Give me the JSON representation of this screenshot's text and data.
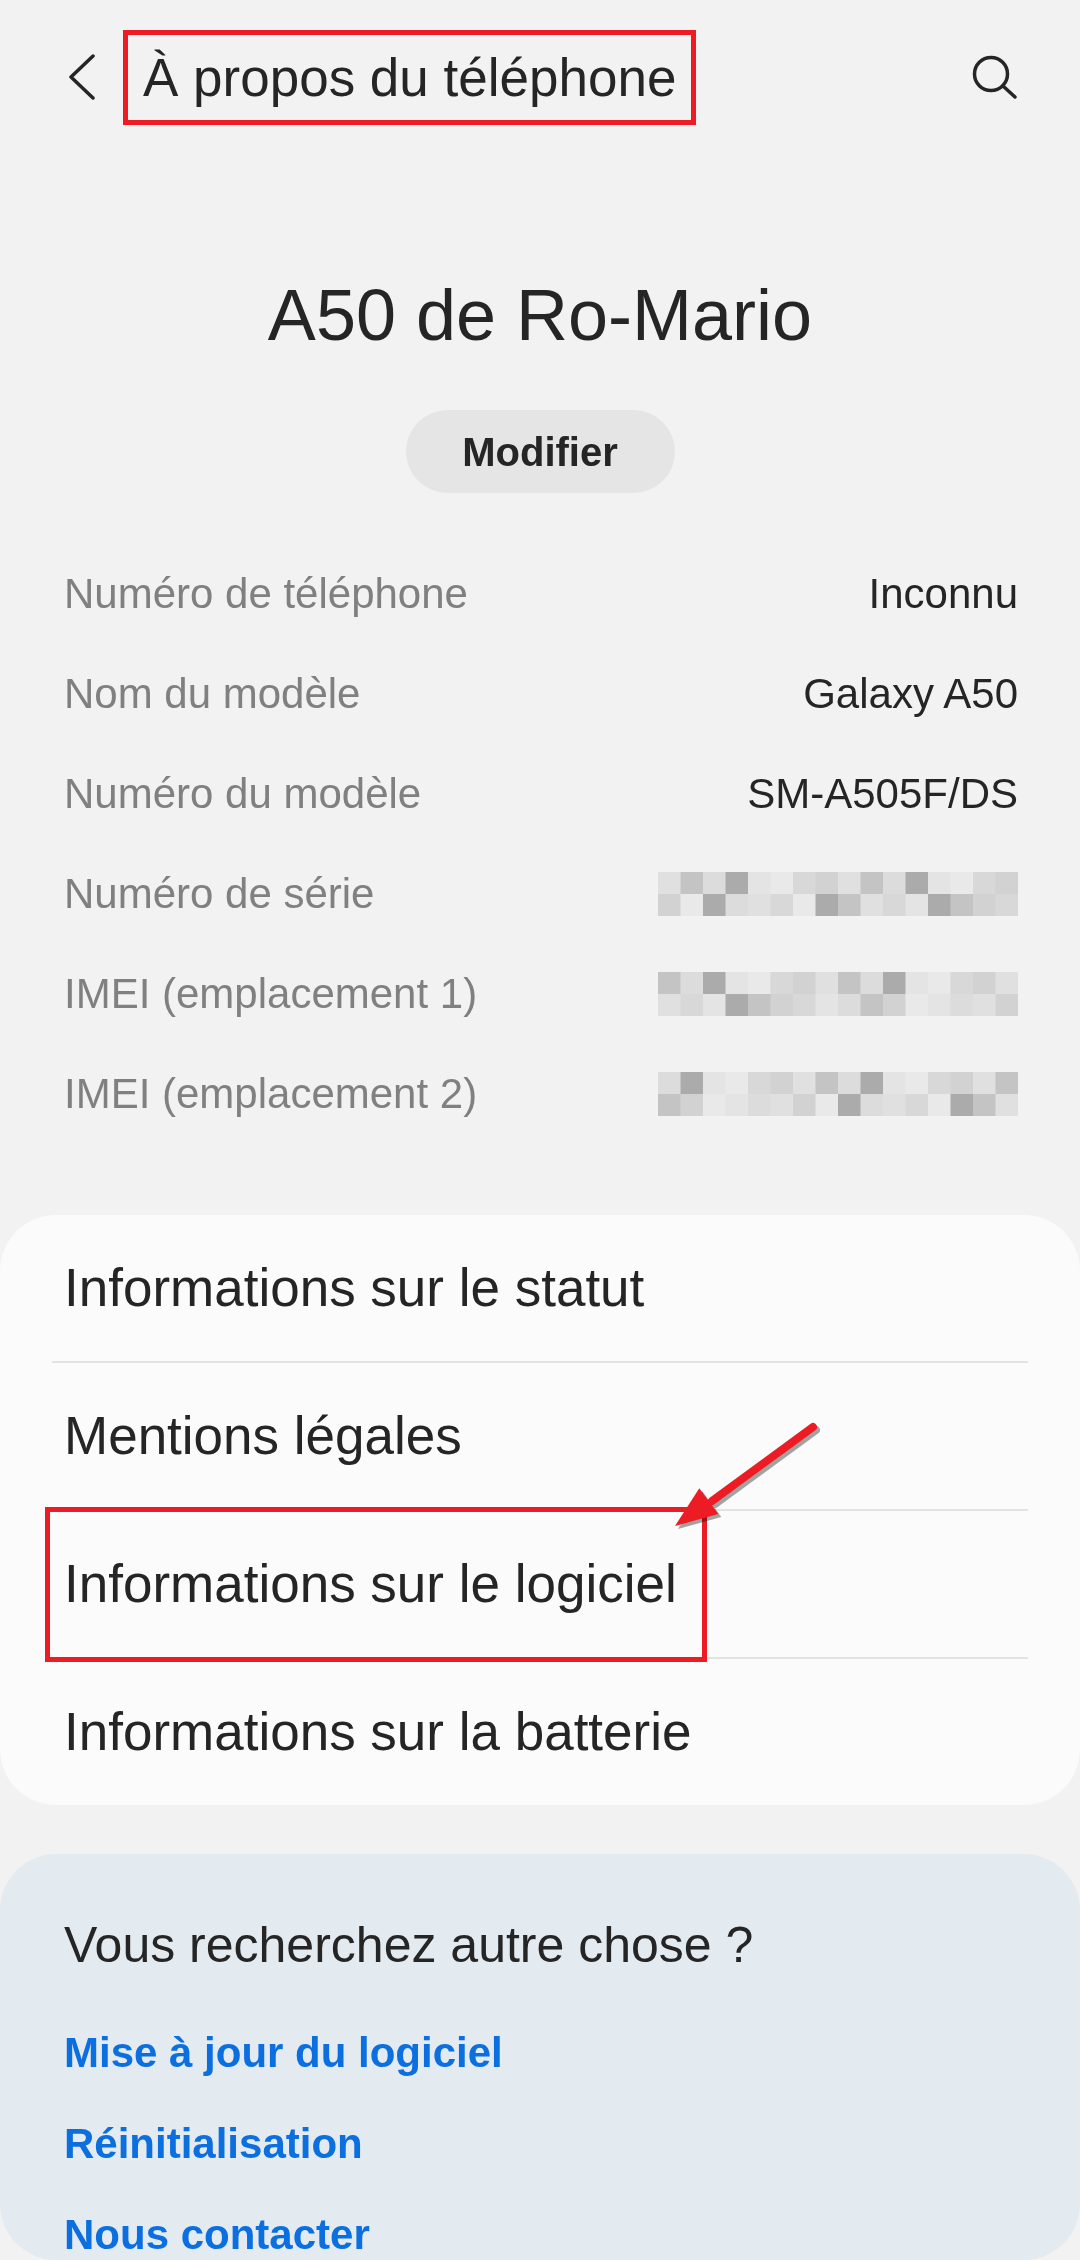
{
  "header": {
    "title": {
      "text": "À propos du téléphone",
      "highlighted": true
    }
  },
  "device": {
    "name": "A50 de Ro-Mario",
    "edit_button": "Modifier"
  },
  "info_rows": [
    {
      "label": "Numéro de téléphone",
      "kind": "text",
      "value": "Inconnu"
    },
    {
      "label": "Nom du modèle",
      "kind": "text",
      "value": "Galaxy A50"
    },
    {
      "label": "Numéro du modèle",
      "kind": "text",
      "value": "SM-A505F/DS"
    },
    {
      "label": "Numéro de série",
      "kind": "redacted"
    },
    {
      "label": "IMEI (emplacement 1)",
      "kind": "redacted"
    },
    {
      "label": "IMEI (emplacement 2)",
      "kind": "redacted"
    }
  ],
  "menu": [
    {
      "label": "Informations sur le statut",
      "highlighted": false
    },
    {
      "label": "Mentions légales",
      "highlighted": false
    },
    {
      "label": "Informations sur le logiciel",
      "highlighted": true
    },
    {
      "label": "Informations sur la batterie",
      "highlighted": false
    }
  ],
  "suggestions": {
    "title": "Vous recherchez autre chose ?",
    "links": [
      "Mise à jour du logiciel",
      "Réinitialisation",
      "Nous contacter"
    ]
  }
}
